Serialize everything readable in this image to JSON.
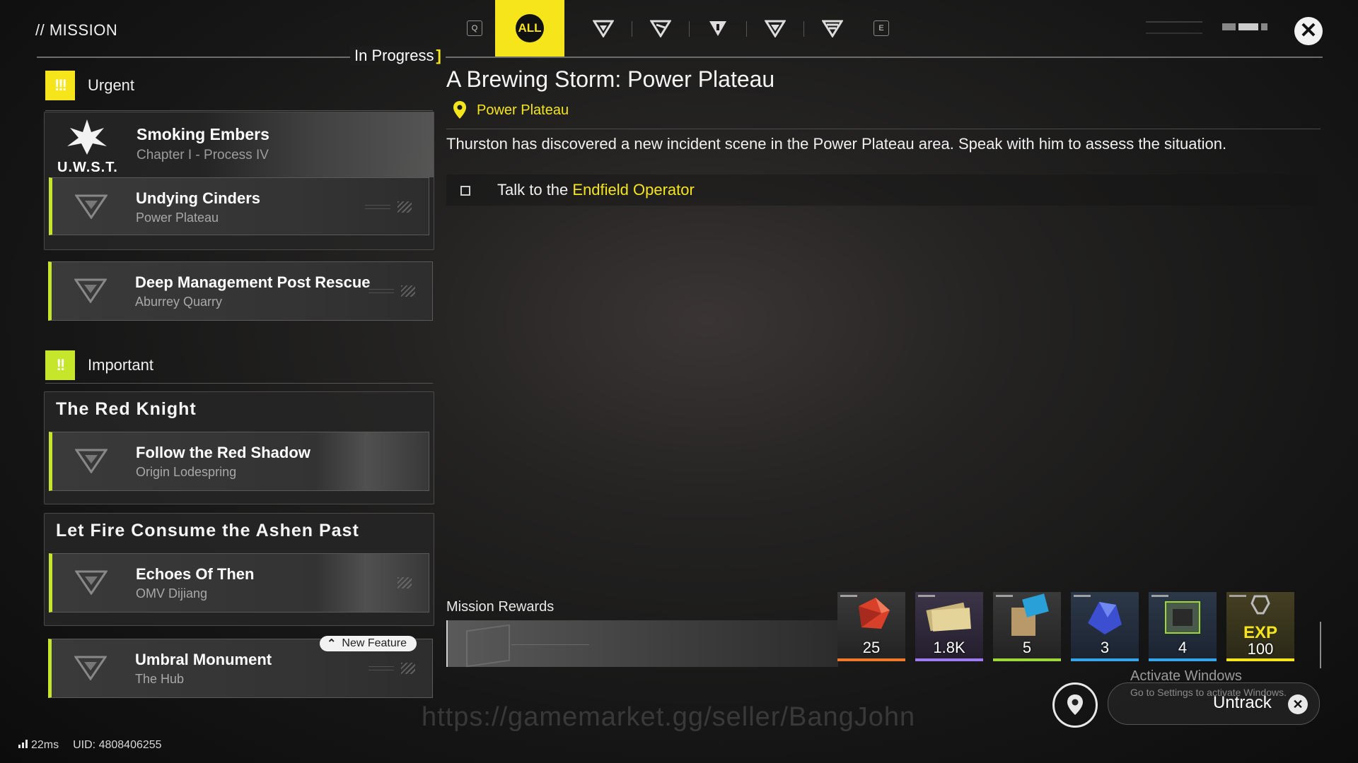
{
  "header": {
    "title": "// MISSION",
    "progress_label": "In Progress",
    "key_left": "Q",
    "key_right": "E",
    "tab_all": "ALL",
    "filter_tabs": [
      "filter-a-icon",
      "filter-b-icon",
      "filter-c-icon",
      "filter-d-icon",
      "filter-e-icon"
    ]
  },
  "sections": {
    "urgent": {
      "label": "Urgent",
      "badge": "!!!",
      "featured": {
        "logo": "U.W.S.T.",
        "title": "Smoking Embers",
        "subtitle": "Chapter I - Process IV"
      },
      "items": [
        {
          "name": "Undying Cinders",
          "location": "Power Plateau"
        },
        {
          "name": "Deep Management Post Rescue",
          "location": "Aburrey Quarry"
        }
      ]
    },
    "important": {
      "label": "Important",
      "badge": "!!",
      "groups": [
        {
          "title": "The Red Knight",
          "item": {
            "name": "Follow the Red Shadow",
            "location": "Origin Lodespring"
          }
        },
        {
          "title": "Let Fire Consume the Ashen Past",
          "item": {
            "name": "Echoes Of Then",
            "location": "OMV Dijiang"
          }
        }
      ],
      "extra": {
        "name": "Umbral Monument",
        "location": "The Hub",
        "badge": "New Feature"
      }
    }
  },
  "detail": {
    "title": "A Brewing Storm: Power Plateau",
    "location": "Power Plateau",
    "description": "Thurston has discovered a new incident scene in the Power Plateau area. Speak with him to assess the situation.",
    "objective_prefix": "Talk to the ",
    "objective_highlight": "Endfield Operator",
    "rewards_label": "Mission Rewards",
    "rewards": [
      {
        "icon": "red-crystal-icon",
        "count": "25",
        "rarity_color": "#f07a2a"
      },
      {
        "icon": "currency-tickets-icon",
        "count": "1.8K",
        "rarity_color": "#a07af0"
      },
      {
        "icon": "exp-card-icon",
        "count": "5",
        "rarity_color": "#9fd63a"
      },
      {
        "icon": "blue-ore-icon",
        "count": "3",
        "rarity_color": "#37a6e8"
      },
      {
        "icon": "chip-module-icon",
        "count": "4",
        "rarity_color": "#37a6e8"
      },
      {
        "icon": "exp-icon",
        "count": "100",
        "label": "EXP",
        "rarity_color": "#f5e51a"
      }
    ],
    "untrack_label": "Untrack"
  },
  "overlay": {
    "activate_title": "Activate Windows",
    "activate_sub": "Go to Settings to activate Windows.",
    "watermark": "https://gamemarket.gg/seller/BangJohn"
  },
  "footer": {
    "ping": "22ms",
    "uid": "UID: 4808406255"
  },
  "colors": {
    "accent_yellow": "#f5e51a",
    "accent_green": "#c6e62b"
  }
}
